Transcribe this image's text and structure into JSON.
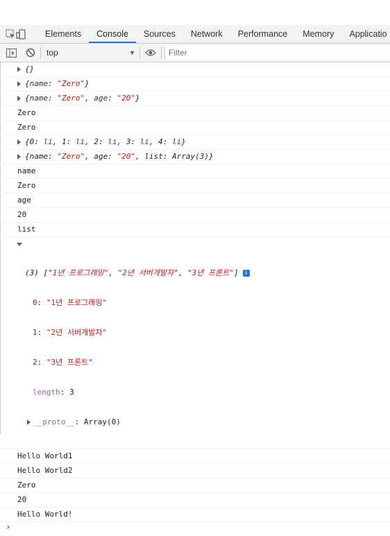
{
  "tabs": [
    "Elements",
    "Console",
    "Sources",
    "Network",
    "Performance",
    "Memory",
    "Applicatio"
  ],
  "active_tab": "Console",
  "toolbar": {
    "context": "top",
    "filter_placeholder": "Filter"
  },
  "console": {
    "l1": "{}",
    "l2": {
      "k": "name",
      "v": "\"Zero\""
    },
    "l3": {
      "k1": "name",
      "v1": "\"Zero\"",
      "k2": "age",
      "v2": "\"20\""
    },
    "l4": "Zero",
    "l5": "Zero",
    "l6": {
      "k0": "0",
      "k1": "1",
      "k2": "2",
      "k3": "3",
      "k4": "4",
      "v": "li"
    },
    "l7": {
      "k1": "name",
      "v1": "\"Zero\"",
      "k2": "age",
      "v2": "\"20\"",
      "k3": "list",
      "v3": "Array(3)"
    },
    "l8": "name",
    "l9": "Zero",
    "l10": "age",
    "l11": "20",
    "l12": "list",
    "array": {
      "count": "(3)",
      "i0": "\"1년 프로그래밍\"",
      "i1": "\"2년 서버개발자\"",
      "i2": "\"3년 프론트\"",
      "length_key": "length",
      "length_val": "3",
      "proto_key": "__proto__",
      "proto_val": "Array(0)"
    },
    "l13": "Hello World1",
    "l14": "Hello World2",
    "l15": "Zero",
    "l16": "20",
    "l17": "Hello World!",
    "prompt": "›"
  }
}
